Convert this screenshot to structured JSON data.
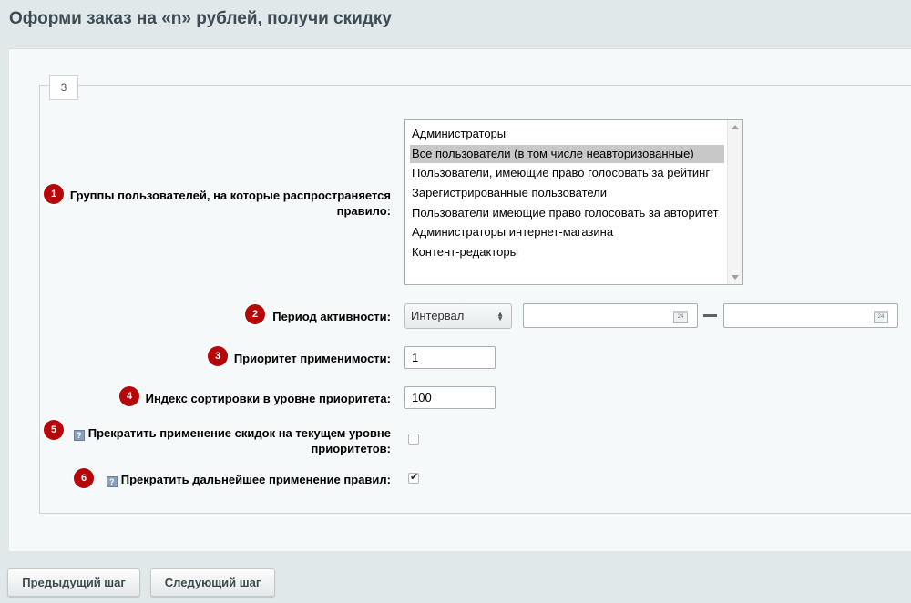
{
  "page": {
    "title": "Оформи заказ на «n» рублей, получи скидку"
  },
  "tab": {
    "label": "3"
  },
  "fields": {
    "groups": {
      "badge": "1",
      "label_line1": "Группы пользователей, на которые распространяется",
      "label_line2": "правило:",
      "options": [
        "Администраторы",
        "Все пользователи (в том числе неавторизованные)",
        "Пользователи, имеющие право голосовать за рейтинг",
        "Зарегистрированные пользователи",
        "Пользователи имеющие право голосовать за авторитет",
        "Администраторы интернет-магазина",
        "Контент-редакторы"
      ],
      "selected_index": 1
    },
    "period": {
      "badge": "2",
      "label": "Период активности:",
      "select_value": "Интервал",
      "date_from": "",
      "date_to": "",
      "calendar_icon_text": "24"
    },
    "priority": {
      "badge": "3",
      "label": "Приоритет применимости:",
      "value": "1"
    },
    "sort": {
      "badge": "4",
      "label": "Индекс сортировки в уровне приоритета:",
      "value": "100"
    },
    "stop_level": {
      "badge": "5",
      "label_line1": "Прекратить применение скидок на текущем уровне",
      "label_line2": "приоритетов:",
      "checked": false
    },
    "stop_rules": {
      "badge": "6",
      "label": "Прекратить дальнейшее применение правил:",
      "checked": true
    }
  },
  "buttons": {
    "prev": "Предыдущий шаг",
    "next": "Следующий шаг"
  },
  "colors": {
    "badge": "#b5060a",
    "background": "#e0e8ea",
    "panel": "#f5f9f9",
    "selected_option": "#c8c8c8"
  }
}
